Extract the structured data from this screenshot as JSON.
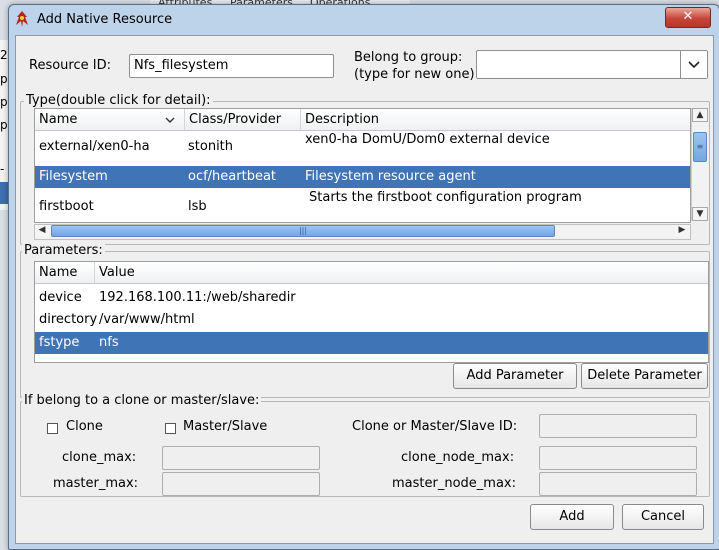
{
  "background": {
    "tabs": [
      "Attributes",
      "Parameters",
      "Operations"
    ],
    "left_chars": [
      "2",
      "p",
      "p",
      "p",
      "-"
    ]
  },
  "dialog": {
    "title": "Add Native Resource",
    "close_glyph": "✕",
    "resource_id_label": "Resource ID:",
    "resource_id_value": "Nfs_filesystem",
    "group_label_line1": "Belong to group:",
    "group_label_line2": "(type for new one)",
    "group_value": "",
    "type_section": {
      "title": "Type(double click for detail):",
      "columns": [
        "Name",
        "Class/Provider",
        "Description"
      ],
      "rows": [
        {
          "name": "external/xen0-ha",
          "provider": "stonith",
          "description": "xen0-ha DomU/Dom0 external device"
        },
        {
          "name": "Filesystem",
          "provider": "ocf/heartbeat",
          "description": "Filesystem resource agent"
        },
        {
          "name": "firstboot",
          "provider": "lsb",
          "description": "Starts the firstboot configuration program"
        }
      ],
      "selected_index": 1
    },
    "params_section": {
      "title": "Parameters:",
      "columns": [
        "Name",
        "Value"
      ],
      "rows": [
        {
          "name": "device",
          "value": "192.168.100.11:/web/sharedir"
        },
        {
          "name": "directory",
          "value": "/var/www/html"
        },
        {
          "name": "fstype",
          "value": "nfs"
        }
      ],
      "selected_index": 2,
      "add_button": "Add Parameter",
      "delete_button": "Delete Parameter"
    },
    "clone_section": {
      "title": "If belong to a clone or master/slave:",
      "clone_label": "Clone",
      "master_slave_label": "Master/Slave",
      "clone_checked": false,
      "master_slave_checked": false,
      "id_label": "Clone or Master/Slave ID:",
      "clone_max_label": "clone_max:",
      "clone_node_max_label": "clone_node_max:",
      "master_max_label": "master_max:",
      "master_node_max_label": "master_node_max:"
    },
    "add_button": "Add",
    "cancel_button": "Cancel"
  },
  "colors": {
    "selection": "#3f74b7",
    "window_frame": "#bcd3ea",
    "close_button": "#c7453a"
  }
}
